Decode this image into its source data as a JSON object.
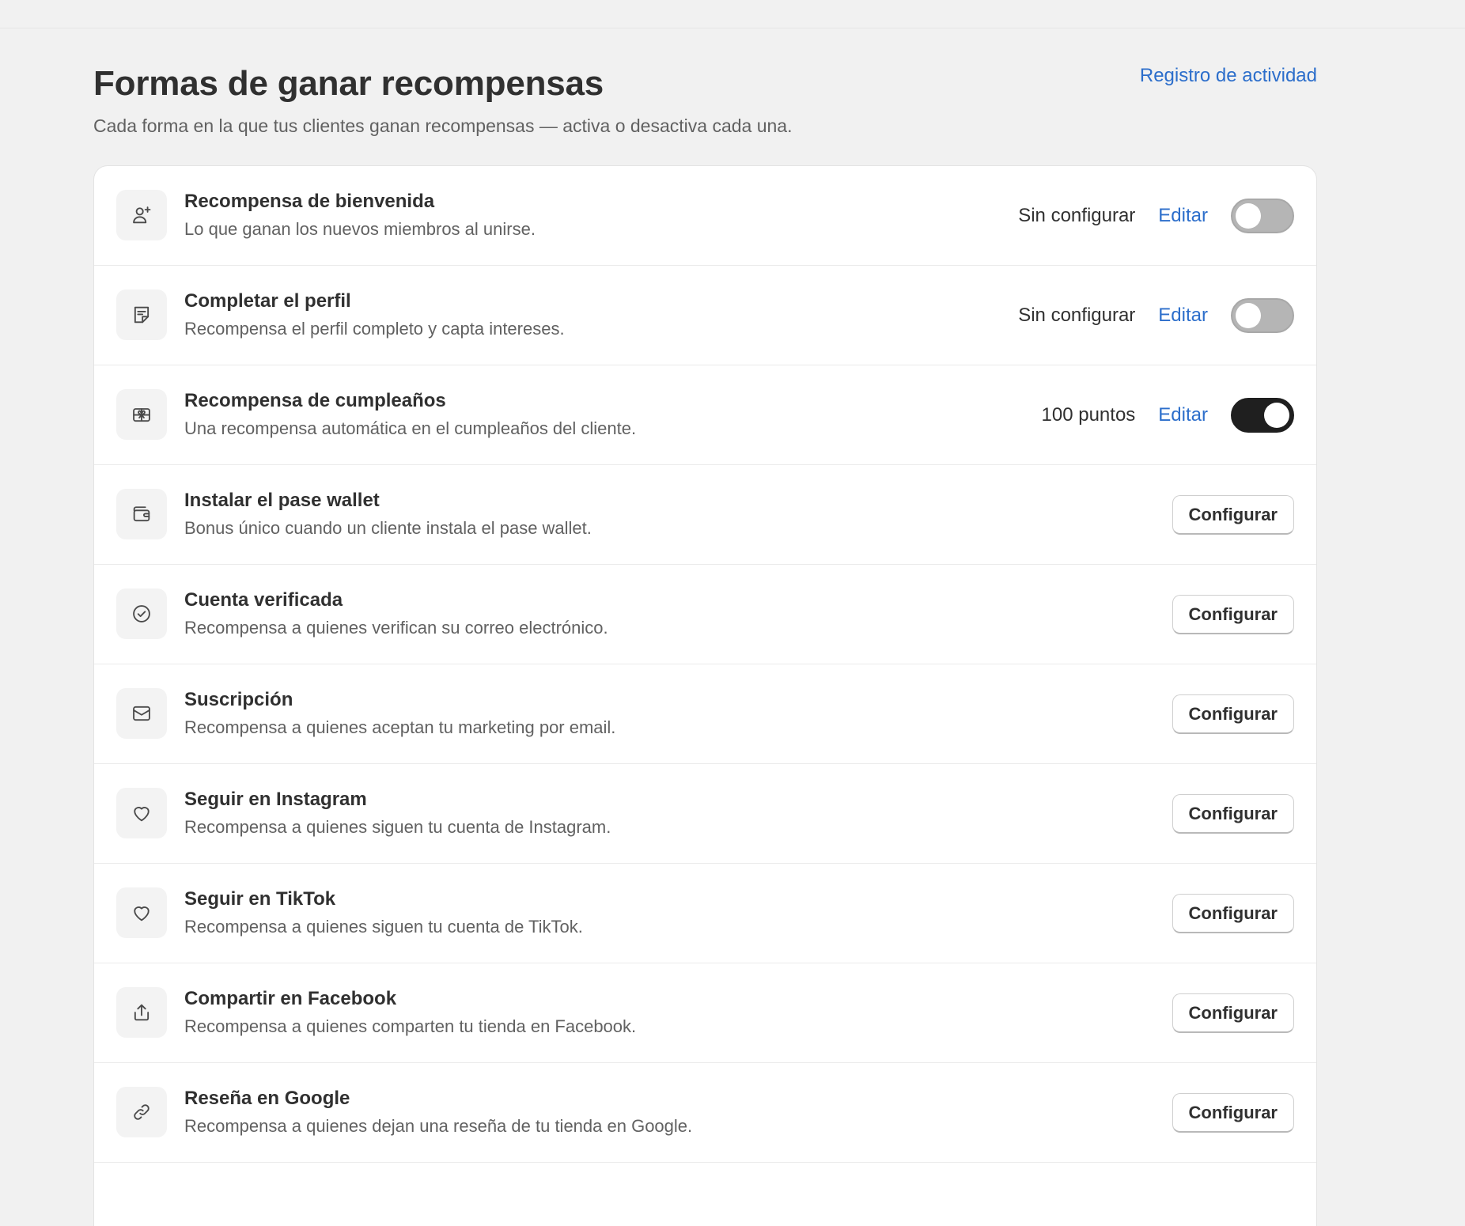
{
  "header": {
    "title": "Formas de ganar recompensas",
    "subtitle": "Cada forma en la que tus clientes ganan recompensas — activa o desactiva cada una.",
    "activity_link": "Registro de actividad"
  },
  "colors": {
    "accent": "#2c6ecb",
    "toggle_on": "#1f1f1f",
    "toggle_off": "#b5b5b5"
  },
  "rows": [
    {
      "icon": "person-add-icon",
      "title": "Recompensa de bienvenida",
      "description": "Lo que ganan los nuevos miembros al unirse.",
      "status": "Sin configurar",
      "edit_label": "Editar",
      "toggle_on": false
    },
    {
      "icon": "note-icon",
      "title": "Completar el perfil",
      "description": "Recompensa el perfil completo y capta intereses.",
      "status": "Sin configurar",
      "edit_label": "Editar",
      "toggle_on": false
    },
    {
      "icon": "gift-icon",
      "title": "Recompensa de cumpleaños",
      "description": "Una recompensa automática en el cumpleaños del cliente.",
      "status": "100 puntos",
      "edit_label": "Editar",
      "toggle_on": true
    },
    {
      "icon": "wallet-icon",
      "title": "Instalar el pase wallet",
      "description": "Bonus único cuando un cliente instala el pase wallet.",
      "button_label": "Configurar"
    },
    {
      "icon": "check-circle-icon",
      "title": "Cuenta verificada",
      "description": "Recompensa a quienes verifican su correo electrónico.",
      "button_label": "Configurar"
    },
    {
      "icon": "email-icon",
      "title": "Suscripción",
      "description": "Recompensa a quienes aceptan tu marketing por email.",
      "button_label": "Configurar"
    },
    {
      "icon": "heart-icon",
      "title": "Seguir en Instagram",
      "description": "Recompensa a quienes siguen tu cuenta de Instagram.",
      "button_label": "Configurar"
    },
    {
      "icon": "heart-icon",
      "title": "Seguir en TikTok",
      "description": "Recompensa a quienes siguen tu cuenta de TikTok.",
      "button_label": "Configurar"
    },
    {
      "icon": "share-icon",
      "title": "Compartir en Facebook",
      "description": "Recompensa a quienes comparten tu tienda en Facebook.",
      "button_label": "Configurar"
    },
    {
      "icon": "link-icon",
      "title": "Reseña en Google",
      "description": "Recompensa a quienes dejan una reseña de tu tienda en Google.",
      "button_label": "Configurar"
    }
  ]
}
